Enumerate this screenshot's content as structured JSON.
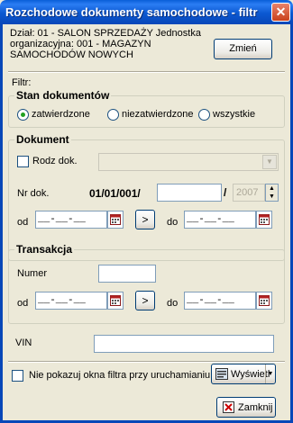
{
  "window": {
    "title": "Rozchodowe dokumenty samochodowe - filtr",
    "close_glyph": "✕"
  },
  "header": {
    "department_text": "Dział: 01 - SALON SPRZEDAŻY Jednostka organizacyjna: 001 - MAGAZYN SAMOCHODÓW NOWYCH",
    "change_button": "Zmień"
  },
  "filtr_label": "Filtr:",
  "stan": {
    "title": "Stan dokumentów",
    "options": [
      "zatwierdzone",
      "niezatwierdzone",
      "wszystkie"
    ],
    "selected": "zatwierdzone"
  },
  "dokument": {
    "title": "Dokument",
    "rodz_label": "Rodz dok.",
    "nr_label": "Nr dok.",
    "nr_prefix": "01/01/001/",
    "nr_value": "",
    "slash": "/",
    "year": "2007",
    "od_label": "od",
    "do_label": "do",
    "date_mask": "__-__-__",
    "next_glyph": ">"
  },
  "transakcja": {
    "title": "Transakcja",
    "numer_label": "Numer",
    "numer_value": "",
    "od_label": "od",
    "do_label": "do",
    "date_mask": "__-__-__",
    "next_glyph": ">"
  },
  "vin": {
    "label": "VIN",
    "value": ""
  },
  "footer": {
    "hide_label": "Nie pokazuj okna filtra przy uruchamianiu",
    "show_button": "Wyświetl",
    "close_button": "Zamknij"
  },
  "colors": {
    "title_bar": "#0b58d1",
    "window_bg": "#ece9d8",
    "radio_dot": "#21a121",
    "close_red": "#c9411c"
  },
  "icons": {
    "calendar": "calendar-icon",
    "display": "display-icon",
    "close": "close-x-icon"
  }
}
